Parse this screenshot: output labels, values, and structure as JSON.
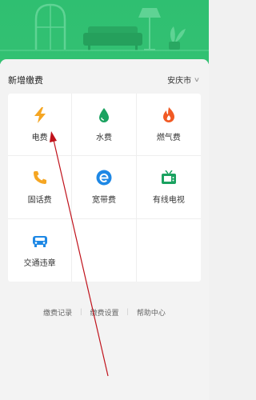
{
  "header": {
    "section_title": "新增缴费",
    "city": "安庆市"
  },
  "services": [
    {
      "label": "电费",
      "icon": "lightning-icon",
      "color": "#f5a623"
    },
    {
      "label": "水费",
      "icon": "water-drop-icon",
      "color": "#1aa260"
    },
    {
      "label": "燃气费",
      "icon": "flame-icon",
      "color": "#f15a24"
    },
    {
      "label": "固话费",
      "icon": "phone-icon",
      "color": "#f5a623"
    },
    {
      "label": "宽带费",
      "icon": "broadband-icon",
      "color": "#1e88e5"
    },
    {
      "label": "有线电视",
      "icon": "tv-icon",
      "color": "#1aa260"
    },
    {
      "label": "交通违章",
      "icon": "car-icon",
      "color": "#1e88e5"
    }
  ],
  "footer": {
    "links": [
      "缴费记录",
      "缴费设置",
      "帮助中心"
    ]
  },
  "colors": {
    "brand_green": "#2fbf71",
    "annotation_arrow": "#c0121b"
  }
}
